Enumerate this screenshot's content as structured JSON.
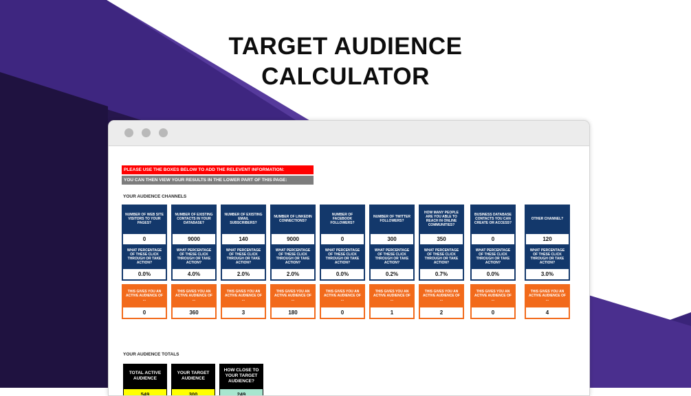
{
  "colors": {
    "purple_dark": "#2a1650",
    "purple_mid": "#3b2478",
    "purple_light": "#5a3ca0",
    "navy": "#13386b",
    "orange": "#f26a1b",
    "red": "#ff0000",
    "grey": "#7d7d7d",
    "yellow": "#ffff00",
    "mint": "#a8e6cf"
  },
  "hero": {
    "title_line1": "TARGET AUDIENCE",
    "title_line2": "CALCULATOR"
  },
  "window": {
    "controls": [
      "close-dot",
      "minimize-dot",
      "maximize-dot"
    ]
  },
  "sheet": {
    "instruction1": "PLEASE USE THE BOXES BELOW TO ADD THE RELEVENT INFORMATION:",
    "instruction2": "YOU CAN THEN VIEW YOUR RESULTS IN THE LOWER PART OF THIS PAGE:",
    "channels_heading": "YOUR AUDIENCE CHANNELS",
    "totals_heading": "YOUR AUDIENCE TOTALS",
    "channels": [
      {
        "question": "NUMBER OF WEB SITE VISITORS TO YOUR PAGES?",
        "value": "0",
        "pct_question": "WHAT PERCENTAGE OF THESE CLICK THROUGH OR TAKE ACTION?",
        "pct": "0.0%",
        "result_label": "THIS GIVES YOU AN ACTIVE AUDIENCE OF ...",
        "result": "0"
      },
      {
        "question": "NUMBER OF EXISTING CONTACTS IN YOUR DATABASE?",
        "value": "9000",
        "pct_question": "WHAT PERCENTAGE OF THESE CLICK THROUGH OR TAKE ACTION?",
        "pct": "4.0%",
        "result_label": "THIS GIVES YOU AN ACTIVE AUDIENCE OF ...",
        "result": "360"
      },
      {
        "question": "NUMBER OF EXISTING EMAIL SUBSCRIBERS?",
        "value": "140",
        "pct_question": "WHAT PERCENTAGE OF THESE CLICK THROUGH OR TAKE ACTION?",
        "pct": "2.0%",
        "result_label": "THIS GIVES YOU AN ACTIVE AUDIENCE OF ...",
        "result": "3"
      },
      {
        "question": "NUMBER OF LINKEDIN CONNECTIONS?",
        "value": "9000",
        "pct_question": "WHAT PERCENTAGE OF THESE CLICK THROUGH OR TAKE ACTION?",
        "pct": "2.0%",
        "result_label": "THIS GIVES YOU AN ACTIVE AUDIENCE OF ...",
        "result": "180"
      },
      {
        "question": "NUMBER OF FACEBOOK FOLLOWERS?",
        "value": "0",
        "pct_question": "WHAT PERCENTAGE OF THESE CLICK THROUGH OR TAKE ACTION?",
        "pct": "0.0%",
        "result_label": "THIS GIVES YOU AN ACTIVE AUDIENCE OF ...",
        "result": "0"
      },
      {
        "question": "NUMBER OF TWITTER FOLLOWERS?",
        "value": "300",
        "pct_question": "WHAT PERCENTAGE OF THESE CLICK THROUGH OR TAKE ACTION?",
        "pct": "0.2%",
        "result_label": "THIS GIVES YOU AN ACTIVE AUDIENCE OF ...",
        "result": "1"
      },
      {
        "question": "HOW MANY PEOPLE ARE YOU ABLE TO REACH IN ONLINE COMMUNITIES?",
        "value": "350",
        "pct_question": "WHAT PERCENTAGE OF THESE CLICK THROUGH OR TAKE ACTION?",
        "pct": "0.7%",
        "result_label": "THIS GIVES YOU AN ACTIVE AUDIENCE OF ...",
        "result": "2"
      },
      {
        "question": "BUSINESS DATABASE CONTACTS YOU CAN CREATE OR ACCESS?",
        "value": "0",
        "pct_question": "WHAT PERCENTAGE OF THESE CLICK THROUGH OR TAKE ACTION?",
        "pct": "0.0%",
        "result_label": "THIS GIVES YOU AN ACTIVE AUDIENCE OF ...",
        "result": "0"
      },
      {
        "question": "OTHER CHANNEL?",
        "value": "120",
        "pct_question": "WHAT PERCENTAGE OF THESE CLICK THROUGH OR TAKE ACTION?",
        "pct": "3.0%",
        "result_label": "THIS GIVES YOU AN ACTIVE AUDIENCE OF ...",
        "result": "4"
      }
    ],
    "totals": [
      {
        "label": "TOTAL ACTIVE AUDIENCE",
        "value": "549",
        "color": "#ffff00"
      },
      {
        "label": "YOUR TARGET AUDIENCE",
        "value": "300",
        "color": "#ffff00"
      },
      {
        "label": "HOW CLOSE TO YOUR TARGET AUDIENCE?",
        "value": "249",
        "color": "#a8e6cf"
      }
    ]
  }
}
